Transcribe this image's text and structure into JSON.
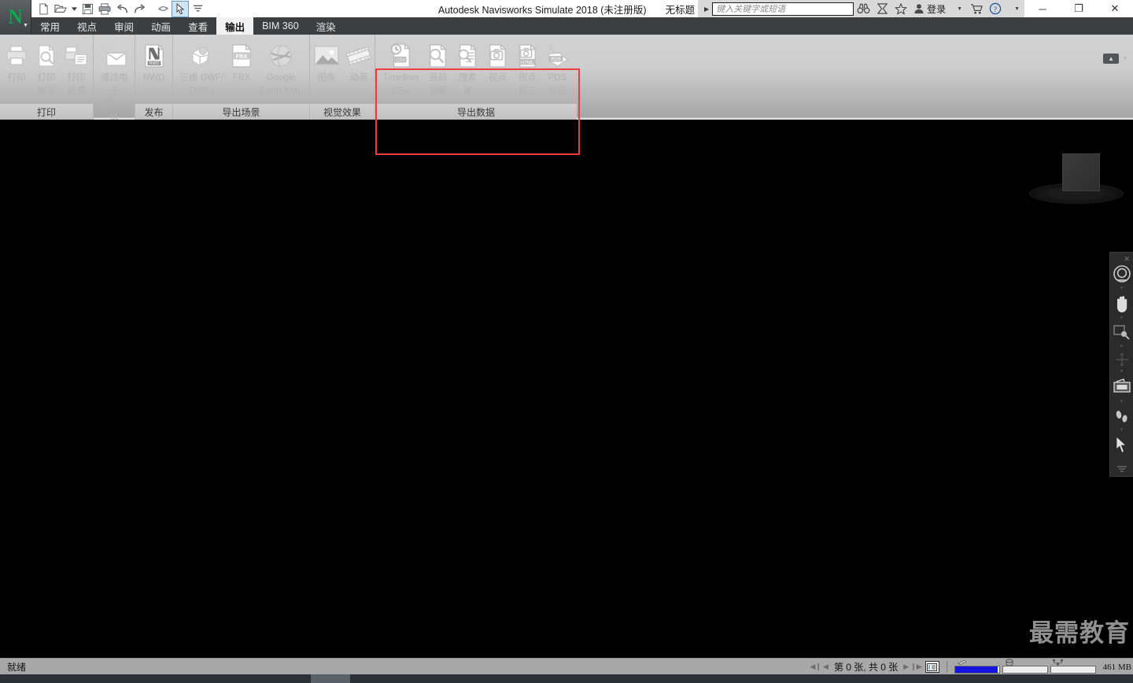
{
  "window": {
    "app_title": "Autodesk Navisworks Simulate 2018 (未注册版)",
    "document_title": "无标题",
    "logo_letter": "N"
  },
  "quick_access": [
    {
      "name": "new-file-icon",
      "glyph": "὜B"
    },
    {
      "name": "open-file-icon",
      "glyph": "Ὄ2"
    },
    {
      "name": "save-icon",
      "glyph": "ὋE"
    },
    {
      "name": "print-icon",
      "glyph": "⎙"
    },
    {
      "name": "undo-icon",
      "glyph": "↶"
    },
    {
      "name": "redo-icon",
      "glyph": "↷"
    },
    {
      "name": "refresh-icon",
      "glyph": "↻"
    },
    {
      "name": "select-cursor-icon",
      "glyph": "➤"
    },
    {
      "name": "customize-qat-icon",
      "glyph": "≡"
    }
  ],
  "infocenter": {
    "search_placeholder": "键入关键字或短语",
    "login_label": "登录",
    "icons": [
      "binoculars-icon",
      "subscription-icon",
      "favorites-star-icon",
      "user-icon",
      "cart-icon",
      "help-icon"
    ]
  },
  "window_controls": {
    "minimize": "─",
    "maximize": "❐",
    "close": "✕"
  },
  "tabs": [
    {
      "label": "常用",
      "active": false
    },
    {
      "label": "视点",
      "active": false
    },
    {
      "label": "审阅",
      "active": false
    },
    {
      "label": "动画",
      "active": false
    },
    {
      "label": "查看",
      "active": false
    },
    {
      "label": "输出",
      "active": true
    },
    {
      "label": "BIM 360",
      "active": false
    },
    {
      "label": "渲染",
      "active": false
    }
  ],
  "ribbon": {
    "highlight_color": "#ef3b3b",
    "groups": [
      {
        "name": "print",
        "label": "打印",
        "highlighted": false,
        "buttons": [
          {
            "name": "print",
            "label": "打印",
            "icon": "printer-icon"
          },
          {
            "name": "print-preview",
            "label": "打印\n预览",
            "icon": "print-preview-icon"
          },
          {
            "name": "print-setup",
            "label": "打印\n设置",
            "icon": "print-setup-icon"
          }
        ]
      },
      {
        "name": "send",
        "label": "发送",
        "highlighted": false,
        "buttons": [
          {
            "name": "send-by-email",
            "label": "通过电子\n邮件发送",
            "icon": "email-icon"
          }
        ]
      },
      {
        "name": "publish",
        "label": "发布",
        "highlighted": false,
        "buttons": [
          {
            "name": "nwd",
            "label": "NWD",
            "icon": "nwd-file-icon"
          }
        ]
      },
      {
        "name": "export-scene",
        "label": "导出场景",
        "highlighted": false,
        "buttons": [
          {
            "name": "dwf-3d",
            "label": "三维 DWF/\nDWFx",
            "icon": "dwf-icon"
          },
          {
            "name": "fbx",
            "label": "FBX",
            "icon": "fbx-file-icon"
          },
          {
            "name": "google-earth-kml",
            "label": "Google\nEarth KML",
            "icon": "globe-icon"
          }
        ]
      },
      {
        "name": "visual-effects",
        "label": "视觉效果",
        "highlighted": false,
        "buttons": [
          {
            "name": "image",
            "label": "图像",
            "icon": "picture-icon"
          },
          {
            "name": "animation",
            "label": "动画",
            "icon": "film-icon"
          }
        ]
      },
      {
        "name": "export-data",
        "label": "导出数据",
        "highlighted": true,
        "buttons": [
          {
            "name": "timeliner-csv",
            "label": "Timeliner\nCSV",
            "icon": "csv-clock-file-icon"
          },
          {
            "name": "current-search",
            "label": "当前\n搜索",
            "icon": "search-file-icon"
          },
          {
            "name": "search-set",
            "label": "搜索\n集",
            "icon": "search-set-file-icon"
          },
          {
            "name": "viewpoint",
            "label": "视点",
            "icon": "camera-file-icon"
          },
          {
            "name": "viewpoint-report",
            "label": "视点\n报告",
            "icon": "html-camera-file-icon"
          },
          {
            "name": "pds-tag",
            "label": "PDS\n标记",
            "icon": "pds-tag-icon"
          }
        ]
      }
    ]
  },
  "navigation_bar": {
    "close_glyph": "✕",
    "items": [
      {
        "name": "steering-wheel-icon",
        "glyph": "◎",
        "dim": false
      },
      {
        "name": "pan-hand-icon",
        "glyph": "✋",
        "dim": false
      },
      {
        "name": "zoom-window-icon",
        "glyph": "ὐD",
        "dim": false
      },
      {
        "name": "orbit-icon",
        "glyph": "✥",
        "dim": true
      },
      {
        "name": "look-around-icon",
        "glyph": "▭",
        "dim": false
      },
      {
        "name": "walk-icon",
        "glyph": "὆3",
        "dim": false
      },
      {
        "name": "select-arrow-icon",
        "glyph": "➤",
        "dim": false
      }
    ]
  },
  "viewport": {
    "watermark": "最需教育",
    "viewcube_name": "view-cube"
  },
  "statusbar": {
    "ready_text": "就绪",
    "sheet_count_text": "第 0 张, 共 0 张",
    "memory_text": "461 MB",
    "nav_buttons": [
      "first-sheet",
      "previous-sheet",
      "next-sheet",
      "last-sheet",
      "sheet-browser"
    ],
    "gauges": [
      {
        "name": "drawing-progress-gauge",
        "fill_percent": 100,
        "fill_color": "#1515e0",
        "icon": "pencil-icon"
      },
      {
        "name": "disk-progress-gauge",
        "fill_percent": 0,
        "fill_color": "#1515e0",
        "icon": "disk-icon"
      },
      {
        "name": "server-progress-gauge",
        "fill_percent": 0,
        "fill_color": "#1515e0",
        "icon": "network-icon"
      }
    ]
  }
}
